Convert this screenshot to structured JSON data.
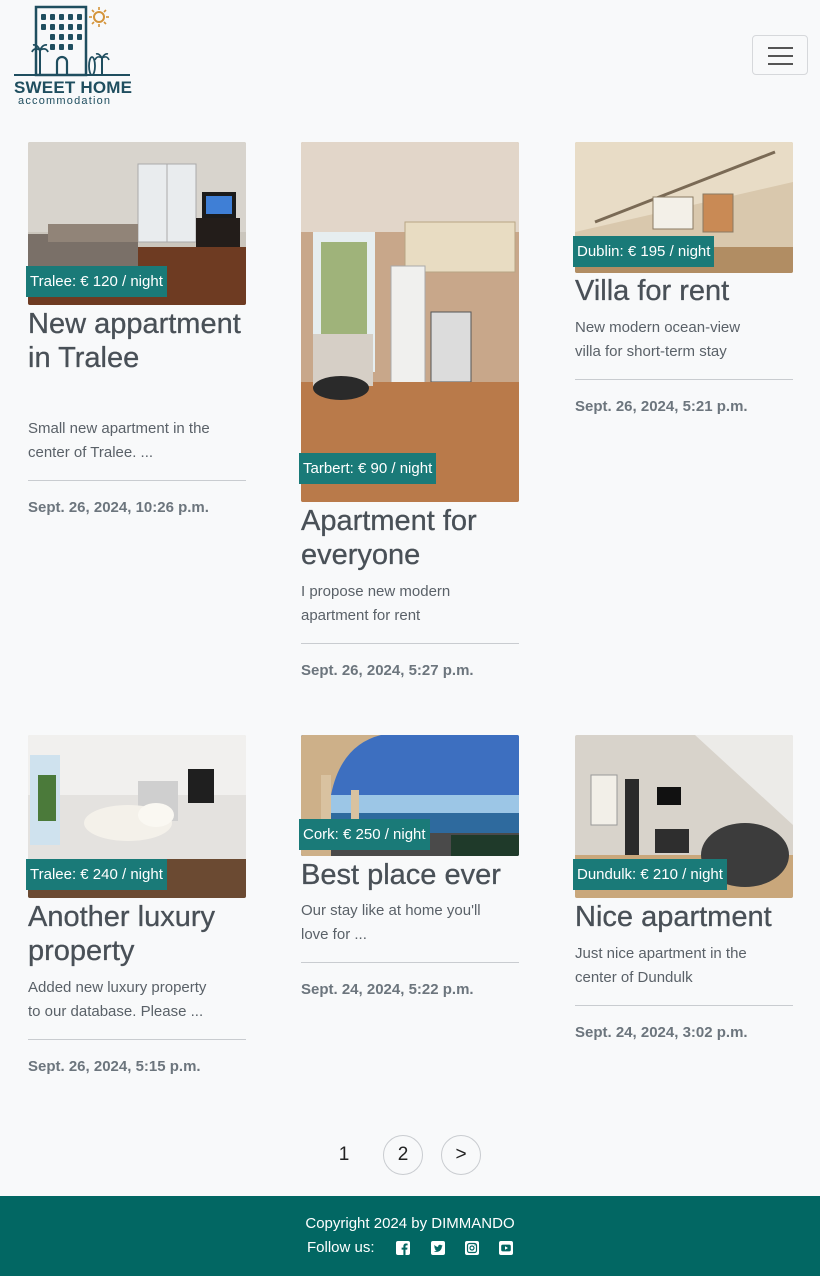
{
  "brand": {
    "title": "SWEET HOME",
    "subtitle": "accommodation",
    "accent": "#1f4e5f",
    "sun_color": "#d4943a"
  },
  "navbar": {
    "toggle_icon": "hamburger-menu-icon"
  },
  "listings": [
    {
      "badge": "Tralee: € 120 / night",
      "title": "New appartment in Tralee",
      "excerpt": "Small new apartment in the center of Tralee. ...",
      "date": "Sept. 26, 2024, 10:26 p.m."
    },
    {
      "badge": "Tarbert: € 90 / night",
      "title": "Apartment for everyone",
      "excerpt": "I propose new modern apartment for rent",
      "date": "Sept. 26, 2024, 5:27 p.m."
    },
    {
      "badge": "Dublin: € 195 / night",
      "title": "Villa for rent",
      "excerpt": "New modern ocean-view villa for short-term stay",
      "date": "Sept. 26, 2024, 5:21 p.m."
    },
    {
      "badge": "Tralee: € 240 / night",
      "title": "Another luxury property",
      "excerpt": "Added new luxury property to our database. Please ...",
      "date": "Sept. 26, 2024, 5:15 p.m."
    },
    {
      "badge": "Cork: € 250 / night",
      "title": "Best place ever",
      "excerpt": "Our stay like at home you'll love for ...",
      "date": "Sept. 24, 2024, 5:22 p.m."
    },
    {
      "badge": "Dundulk: € 210 / night",
      "title": "Nice apartment",
      "excerpt": "Just nice apartment in the center of Dundulk",
      "date": "Sept. 24, 2024, 3:02 p.m."
    }
  ],
  "pagination": {
    "current": "1",
    "next_page": "2",
    "next_arrow": ">"
  },
  "footer": {
    "copyright": "Copyright 2024 by DIMMANDO",
    "follow_label": "Follow us:",
    "social_icons": [
      "facebook-icon",
      "twitter-icon",
      "instagram-icon",
      "youtube-icon"
    ],
    "background": "#026763"
  },
  "colors": {
    "badge": "#1a7a78",
    "page_bg": "#f8f9fa"
  }
}
